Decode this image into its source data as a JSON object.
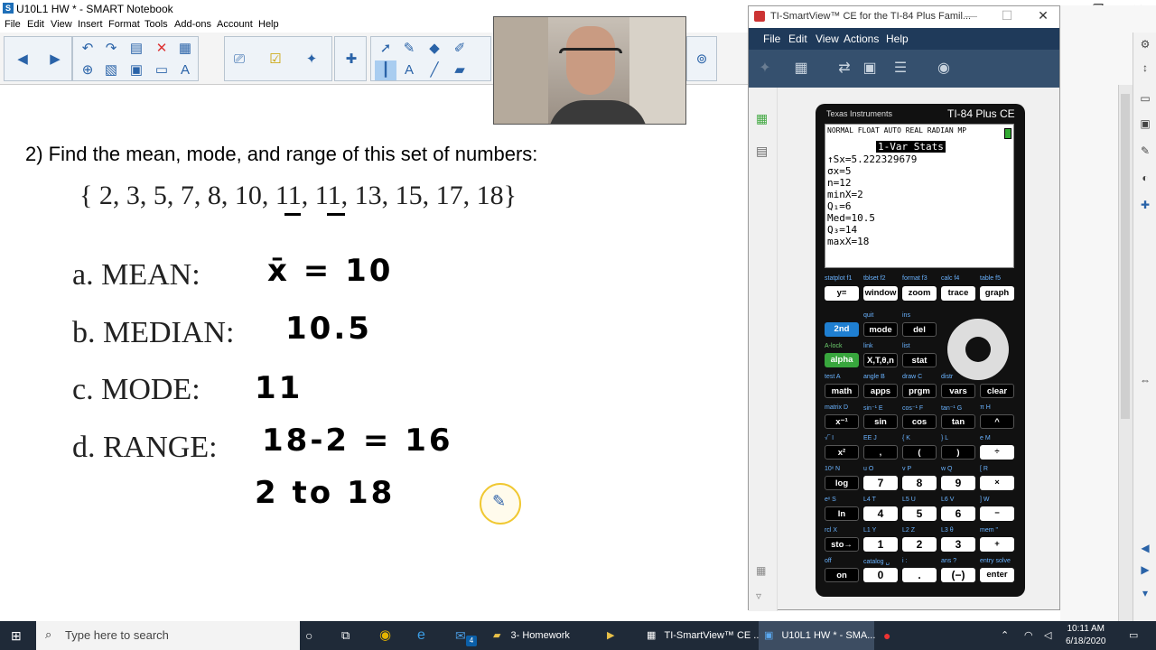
{
  "window": {
    "title": "U10L1 HW * - SMART Notebook",
    "minimize": "—",
    "maximize": "☐",
    "close": "✕"
  },
  "menu": [
    "File",
    "Edit",
    "View",
    "Insert",
    "Format",
    "Tools",
    "Add-ons",
    "Account",
    "Help"
  ],
  "toolbar": {
    "icons": [
      "back-icon",
      "forward-icon",
      "undo-icon",
      "redo-icon",
      "delete-icon",
      "screen-shade-icon",
      "table-icon",
      "select-icon",
      "pen-icon",
      "eraser-icon",
      "shapes-icon",
      "line-icon",
      "text-icon"
    ]
  },
  "page": {
    "question": "2)  Find the mean, mode, and range of this set of numbers:",
    "number_set": "{ 2, 3, 5, 7, 8, 10, 11, 11, 13, 15, 17, 18}",
    "items": [
      {
        "label": "a.   MEAN:",
        "answer": "x̄ = 10"
      },
      {
        "label": "b.   MEDIAN:",
        "answer": "10.5"
      },
      {
        "label": "c.   MODE:",
        "answer": "11"
      },
      {
        "label": "d.   RANGE:",
        "answer": "18-2 = 16"
      }
    ],
    "extra_answer": "2 to 18"
  },
  "ti_window": {
    "title": "TI-SmartView™ CE for the TI-84 Plus Famil...",
    "menu": [
      "File",
      "Edit",
      "View",
      "Actions",
      "Help"
    ],
    "brand": "Texas Instruments",
    "model": "TI-84 Plus CE",
    "status_bar": "NORMAL FLOAT AUTO REAL RADIAN MP",
    "screen_title": "1-Var Stats",
    "screen_lines": [
      "↑Sx=5.222329679",
      " σx=5",
      " n=12",
      " minX=2",
      " Q₁=6",
      " Med=10.5",
      " Q₃=14",
      " maxX=18"
    ],
    "function_keys": [
      "y=",
      "window",
      "zoom",
      "trace",
      "graph"
    ],
    "function_subs": [
      "statplot f1",
      "tblset f2",
      "format f3",
      "calc f4",
      "table f5"
    ],
    "keys": [
      [
        "2nd",
        "mode",
        "del"
      ],
      [
        "alpha",
        "X,T,θ,n",
        "stat"
      ],
      [
        "math",
        "apps",
        "prgm",
        "vars",
        "clear"
      ],
      [
        "x⁻¹",
        "sin",
        "cos",
        "tan",
        "^"
      ],
      [
        "x²",
        ",",
        "(",
        ")",
        "÷"
      ],
      [
        "log",
        "7",
        "8",
        "9",
        "×"
      ],
      [
        "ln",
        "4",
        "5",
        "6",
        "−"
      ],
      [
        "sto→",
        "1",
        "2",
        "3",
        "+"
      ],
      [
        "on",
        "0",
        ".",
        "(−)",
        "enter"
      ]
    ],
    "key_subs": [
      [
        "",
        "quit",
        "ins"
      ],
      [
        "A-lock",
        "link",
        "list"
      ],
      [
        "test  A",
        "angle  B",
        "draw  C",
        "distr",
        ""
      ],
      [
        "matrix  D",
        "sin⁻¹  E",
        "cos⁻¹  F",
        "tan⁻¹  G",
        "π  H"
      ],
      [
        "√‾  I",
        "EE  J",
        "{  K",
        "}  L",
        "e  M"
      ],
      [
        "10ˣ  N",
        "u  O",
        "v  P",
        "w  Q",
        "[  R"
      ],
      [
        "eˣ  S",
        "L4  T",
        "L5  U",
        "L6  V",
        "]  W"
      ],
      [
        "rcl  X",
        "L1  Y",
        "L2  Z",
        "L3  θ",
        "mem  \""
      ],
      [
        "off",
        "catalog  ␣",
        "i  :",
        "ans  ?",
        "entry solve"
      ]
    ]
  },
  "taskbar": {
    "search_placeholder": "Type here to search",
    "items": [
      "3- Homework",
      "TI-SmartView™ CE ...",
      "U10L1 HW * - SMA..."
    ],
    "badge": "4",
    "time": "10:11 AM",
    "date": "6/18/2020"
  }
}
